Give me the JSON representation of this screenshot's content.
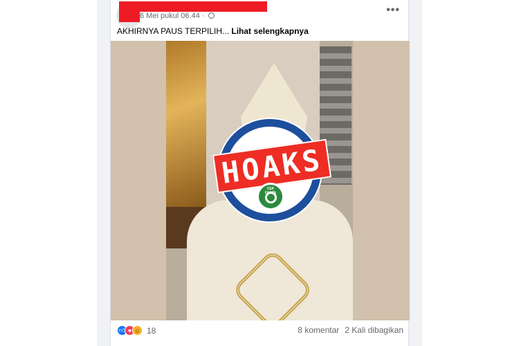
{
  "post": {
    "timestamp": "6 Mei pukul 06.44 · ",
    "caption": "AKHIRNYA PAUS TERPILIH... ",
    "see_more": "Lihat selengkapnya",
    "more_icon": "•••"
  },
  "badge": {
    "label": "HOAKS",
    "seal_text": "CEK FAKTA"
  },
  "footer": {
    "reaction_count": "18",
    "comments": "8 komentar",
    "shares": "2 Kali dibagikan",
    "reaction_icons": [
      "like-icon",
      "love-icon",
      "haha-icon"
    ]
  },
  "colors": {
    "redaction": "#ee1b24",
    "hoaks_red": "#ee2d24",
    "badge_blue": "#1e4f9c",
    "secondary_text": "#65676b"
  }
}
